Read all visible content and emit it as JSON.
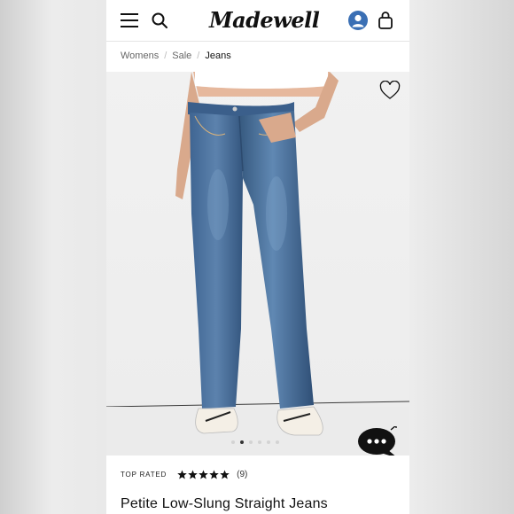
{
  "header": {
    "brand": "Madewell",
    "menu_icon": "hamburger-menu-icon",
    "search_icon": "search-icon",
    "account_icon": "user-account-icon",
    "bag_icon": "shopping-bag-icon",
    "account_color": "#3a6fb4"
  },
  "breadcrumb": {
    "items": [
      "Womens",
      "Sale",
      "Jeans"
    ],
    "separator": "/"
  },
  "gallery": {
    "favorite_icon": "heart-outline-icon",
    "active_slide": 2,
    "slide_count": 6,
    "chat_icon": "chat-bubble-icon"
  },
  "product": {
    "badge": "TOP RATED",
    "rating": 5,
    "review_count": "(9)",
    "title": "Petite Low-Slung Straight Jeans"
  }
}
